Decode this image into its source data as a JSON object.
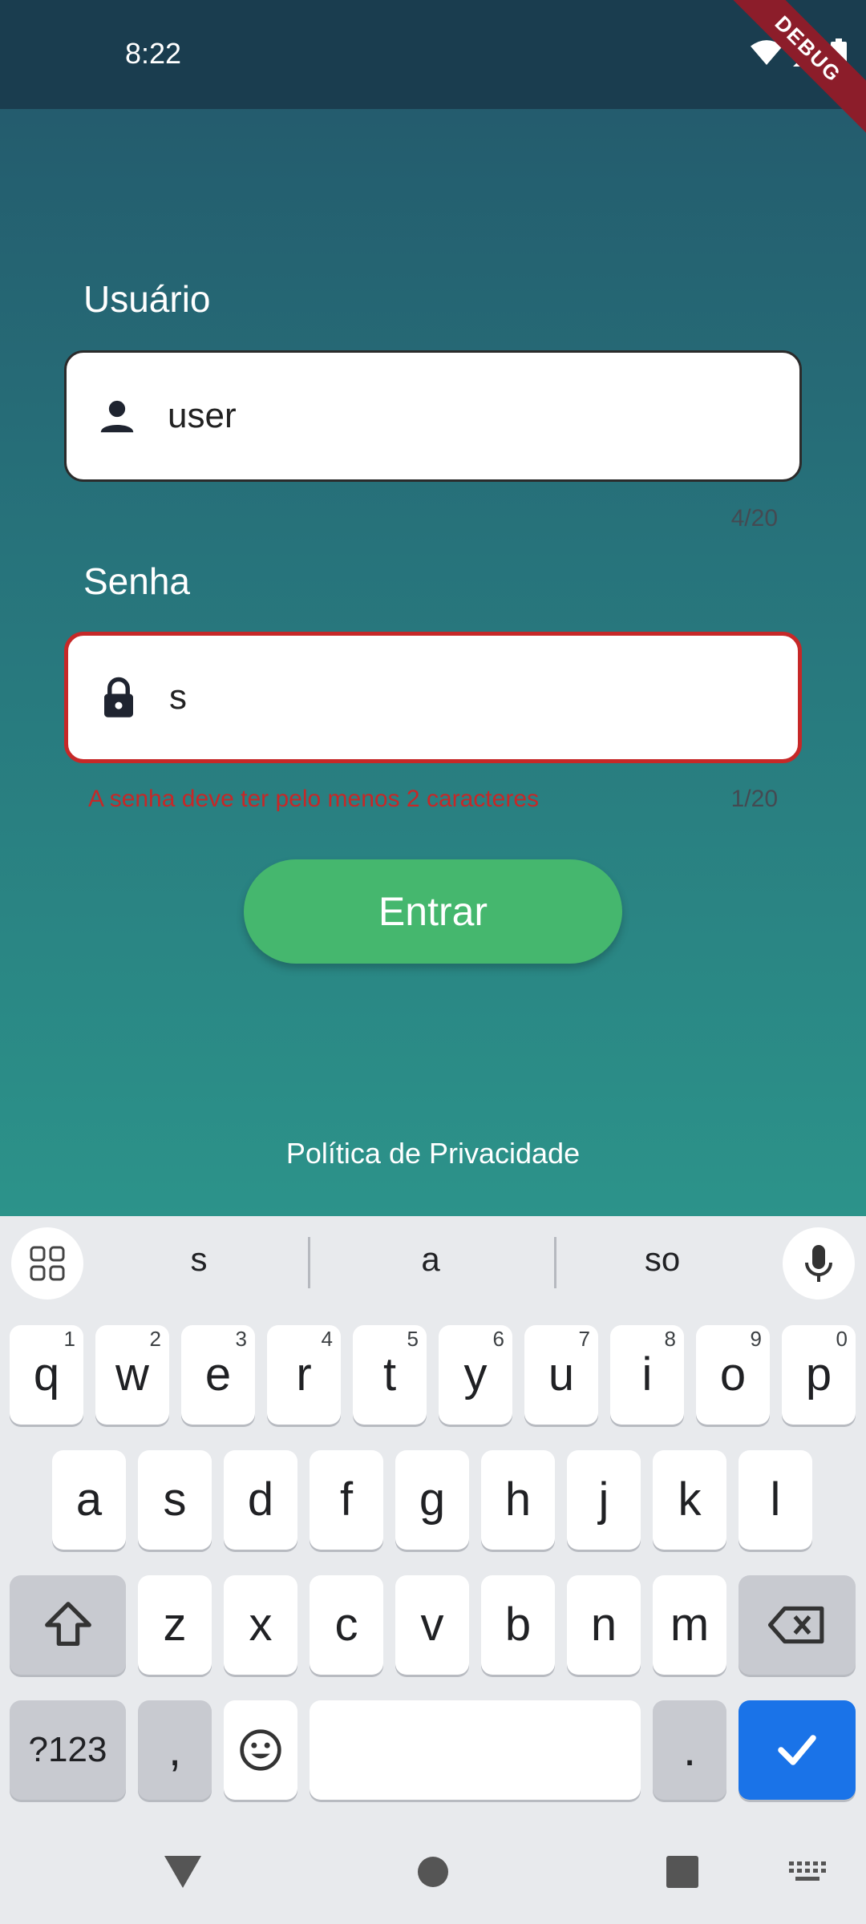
{
  "status_bar": {
    "time": "8:22",
    "debug_banner": "DEBUG"
  },
  "form": {
    "username": {
      "label": "Usuário",
      "value": "user",
      "counter": "4/20",
      "icon": "person-icon"
    },
    "password": {
      "label": "Senha",
      "value": "s",
      "counter": "1/20",
      "icon": "lock-icon",
      "error": "A senha deve ter pelo menos 2 caracteres"
    },
    "submit_label": "Entrar",
    "privacy_link": "Política de Privacidade"
  },
  "colors": {
    "accent": "#45b76e",
    "error": "#c62828",
    "gradient_top": "#23566a",
    "gradient_bottom": "#2c938a",
    "enter_key": "#1a73e8"
  },
  "keyboard": {
    "suggestions": [
      "s",
      "a",
      "so"
    ],
    "row1": [
      {
        "k": "q",
        "h": "1"
      },
      {
        "k": "w",
        "h": "2"
      },
      {
        "k": "e",
        "h": "3"
      },
      {
        "k": "r",
        "h": "4"
      },
      {
        "k": "t",
        "h": "5"
      },
      {
        "k": "y",
        "h": "6"
      },
      {
        "k": "u",
        "h": "7"
      },
      {
        "k": "i",
        "h": "8"
      },
      {
        "k": "o",
        "h": "9"
      },
      {
        "k": "p",
        "h": "0"
      }
    ],
    "row2": [
      "a",
      "s",
      "d",
      "f",
      "g",
      "h",
      "j",
      "k",
      "l"
    ],
    "row3": [
      "z",
      "x",
      "c",
      "v",
      "b",
      "n",
      "m"
    ],
    "symbols_label": "?123",
    "comma": ",",
    "period": "."
  }
}
